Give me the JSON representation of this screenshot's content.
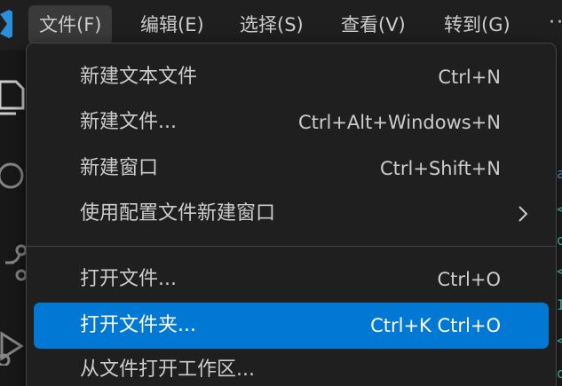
{
  "menubar": {
    "items": [
      {
        "label": "文件(F)"
      },
      {
        "label": "编辑(E)"
      },
      {
        "label": "选择(S)"
      },
      {
        "label": "查看(V)"
      },
      {
        "label": "转到(G)"
      }
    ],
    "more": "··"
  },
  "file_menu": {
    "groups": [
      [
        {
          "label": "新建文本文件",
          "shortcut": "Ctrl+N"
        },
        {
          "label": "新建文件...",
          "shortcut": "Ctrl+Alt+Windows+N"
        },
        {
          "label": "新建窗口",
          "shortcut": "Ctrl+Shift+N"
        },
        {
          "label": "使用配置文件新建窗口",
          "shortcut": ""
        }
      ],
      [
        {
          "label": "打开文件...",
          "shortcut": "Ctrl+O"
        },
        {
          "label": "打开文件夹...",
          "shortcut": "Ctrl+K Ctrl+O"
        },
        {
          "label": "从文件打开工作区...",
          "shortcut": ""
        }
      ]
    ],
    "selected_item": "打开文件夹..."
  },
  "colors": {
    "menu_bg": "#1f1f1f",
    "highlight": "#0078d4",
    "text": "#cccccc",
    "border": "#454545"
  }
}
